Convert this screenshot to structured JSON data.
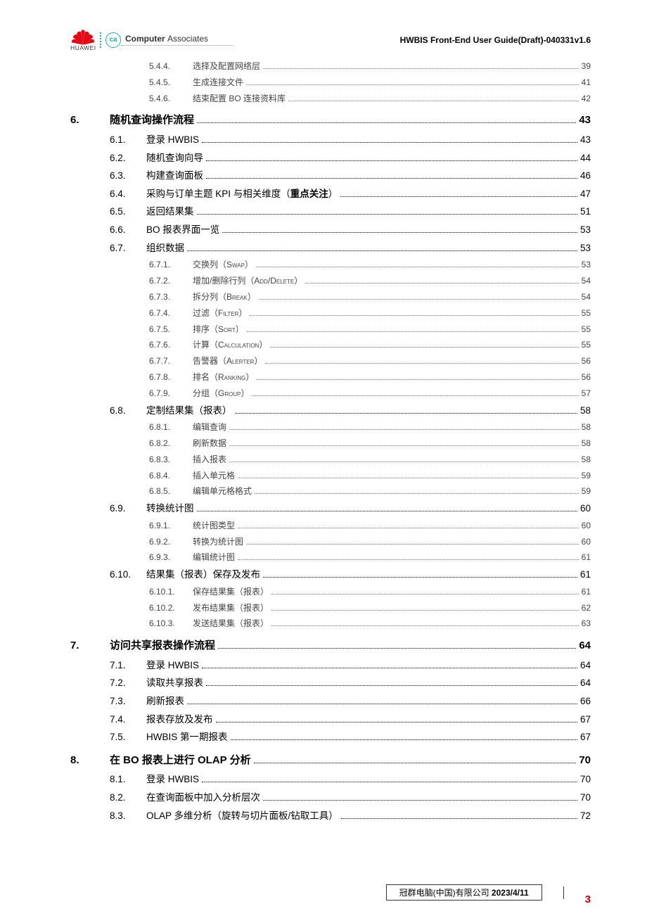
{
  "header": {
    "huawei_label": "HUAWEI",
    "ca_bold": "Computer ",
    "ca_light": "Associates",
    "doc_title": "HWBIS Front-End User Guide(Draft)-040331v1.6"
  },
  "toc": [
    {
      "level": 3,
      "num": "5.4.4.",
      "title": "选择及配置网络层",
      "page": "39"
    },
    {
      "level": 3,
      "num": "5.4.5.",
      "title": "生成连接文件",
      "page": "41"
    },
    {
      "level": 3,
      "num": "5.4.6.",
      "title": "结束配置 BO 连接资料库",
      "page": "42"
    },
    {
      "level": 1,
      "num": "6.",
      "title": "随机查询操作流程",
      "page": "43"
    },
    {
      "level": 2,
      "num": "6.1.",
      "title": "登录 HWBIS",
      "page": "43"
    },
    {
      "level": 2,
      "num": "6.2.",
      "title": "随机查询向导",
      "page": "44"
    },
    {
      "level": 2,
      "num": "6.3.",
      "title": "构建查询面板",
      "page": "46"
    },
    {
      "level": 2,
      "num": "6.4.",
      "title": "采购与订单主题 KPI 与相关维度（<span class='emph'>重点关注</span>）",
      "page": "47"
    },
    {
      "level": 2,
      "num": "6.5.",
      "title": "返回结果集",
      "page": "51"
    },
    {
      "level": 2,
      "num": "6.6.",
      "title": "BO 报表界面一览",
      "page": "53"
    },
    {
      "level": 2,
      "num": "6.7.",
      "title": "组织数据",
      "page": "53"
    },
    {
      "level": 3,
      "num": "6.7.1.",
      "title": "交换列（S<span class='sc'>wap</span>）",
      "page": "53"
    },
    {
      "level": 3,
      "num": "6.7.2.",
      "title": "增加/删除行列（A<span class='sc'>dd</span>/D<span class='sc'>elete</span>）",
      "page": "54"
    },
    {
      "level": 3,
      "num": "6.7.3.",
      "title": "拆分列（B<span class='sc'>reak</span>）",
      "page": "54"
    },
    {
      "level": 3,
      "num": "6.7.4.",
      "title": "过滤（F<span class='sc'>ilter</span>）",
      "page": "55"
    },
    {
      "level": 3,
      "num": "6.7.5.",
      "title": "排序（S<span class='sc'>ort</span>）",
      "page": "55"
    },
    {
      "level": 3,
      "num": "6.7.6.",
      "title": "计算（C<span class='sc'>alculation</span>）",
      "page": "55"
    },
    {
      "level": 3,
      "num": "6.7.7.",
      "title": "告警器（A<span class='sc'>lerter</span>）",
      "page": "56"
    },
    {
      "level": 3,
      "num": "6.7.8.",
      "title": "排名（R<span class='sc'>anking</span>）",
      "page": "56"
    },
    {
      "level": 3,
      "num": "6.7.9.",
      "title": "分组（G<span class='sc'>roup</span>）",
      "page": "57"
    },
    {
      "level": 2,
      "num": "6.8.",
      "title": "定制结果集（报表）",
      "page": "58"
    },
    {
      "level": 3,
      "num": "6.8.1.",
      "title": "编辑查询",
      "page": "58"
    },
    {
      "level": 3,
      "num": "6.8.2.",
      "title": "刷新数据",
      "page": "58"
    },
    {
      "level": 3,
      "num": "6.8.3.",
      "title": "插入报表",
      "page": "58"
    },
    {
      "level": 3,
      "num": "6.8.4.",
      "title": "插入单元格",
      "page": "59"
    },
    {
      "level": 3,
      "num": "6.8.5.",
      "title": "编辑单元格格式",
      "page": "59"
    },
    {
      "level": 2,
      "num": "6.9.",
      "title": "转换统计图",
      "page": "60"
    },
    {
      "level": 3,
      "num": "6.9.1.",
      "title": "统计图类型",
      "page": "60"
    },
    {
      "level": 3,
      "num": "6.9.2.",
      "title": "转换为统计图",
      "page": "60"
    },
    {
      "level": 3,
      "num": "6.9.3.",
      "title": "编辑统计图",
      "page": "61"
    },
    {
      "level": 2,
      "num": "6.10.",
      "title": "结果集（报表）保存及发布",
      "page": "61"
    },
    {
      "level": 3,
      "num": "6.10.1.",
      "title": "保存结果集（报表）",
      "page": "61"
    },
    {
      "level": 3,
      "num": "6.10.2.",
      "title": "发布结果集（报表）",
      "page": "62"
    },
    {
      "level": 3,
      "num": "6.10.3.",
      "title": "发送结果集（报表）",
      "page": "63"
    },
    {
      "level": 1,
      "num": "7.",
      "title": "访问共享报表操作流程",
      "page": "64"
    },
    {
      "level": 2,
      "num": "7.1.",
      "title": "登录 HWBIS",
      "page": "64"
    },
    {
      "level": 2,
      "num": "7.2.",
      "title": "读取共享报表",
      "page": "64"
    },
    {
      "level": 2,
      "num": "7.3.",
      "title": "刷新报表",
      "page": "66"
    },
    {
      "level": 2,
      "num": "7.4.",
      "title": "报表存放及发布",
      "page": "67"
    },
    {
      "level": 2,
      "num": "7.5.",
      "title": "HWBIS 第一期报表",
      "page": "67"
    },
    {
      "level": 1,
      "num": "8.",
      "title": "在 BO 报表上进行 OLAP 分析",
      "page": "70"
    },
    {
      "level": 2,
      "num": "8.1.",
      "title": "登录 HWBIS",
      "page": "70"
    },
    {
      "level": 2,
      "num": "8.2.",
      "title": "在查询面板中加入分析层次",
      "page": "70"
    },
    {
      "level": 2,
      "num": "8.3.",
      "title": "OLAP 多维分析（旋转与切片面板/钻取工具）",
      "page": "72"
    }
  ],
  "footer": {
    "company_prefix": "冠群电脑(中国)有限公司 ",
    "date": "2023/4/11",
    "page_number": "3"
  }
}
